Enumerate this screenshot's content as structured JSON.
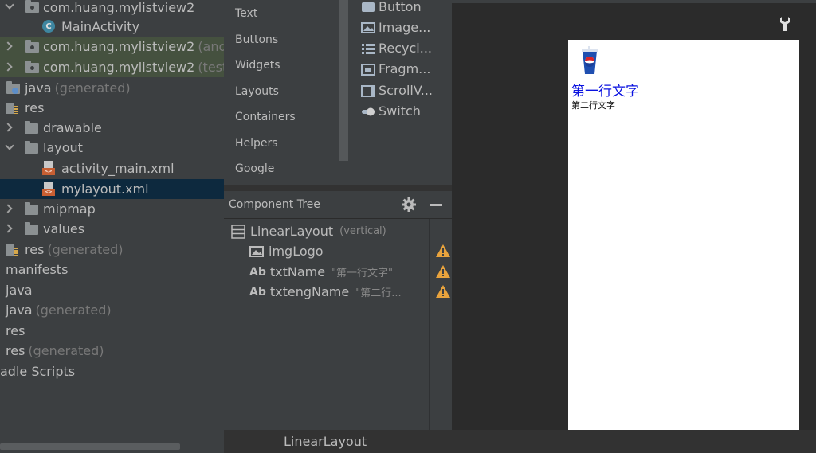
{
  "project_tree": {
    "rows": [
      {
        "label": "com.huang.mylistview2",
        "muted": ""
      },
      {
        "label": "MainActivity",
        "muted": ""
      },
      {
        "label": "com.huang.mylistview2",
        "muted": "(andro"
      },
      {
        "label": "com.huang.mylistview2",
        "muted": "(test)"
      },
      {
        "label": "java",
        "muted": "(generated)"
      },
      {
        "label": "res",
        "muted": ""
      },
      {
        "label": "drawable",
        "muted": ""
      },
      {
        "label": "layout",
        "muted": ""
      },
      {
        "label": "activity_main.xml",
        "muted": ""
      },
      {
        "label": "mylayout.xml",
        "muted": ""
      },
      {
        "label": "mipmap",
        "muted": ""
      },
      {
        "label": "values",
        "muted": ""
      },
      {
        "label": "res",
        "muted": "(generated)"
      },
      {
        "label": "manifests",
        "muted": ""
      },
      {
        "label": "java",
        "muted": ""
      },
      {
        "label": "java",
        "muted": "(generated)"
      },
      {
        "label": "res",
        "muted": ""
      },
      {
        "label": "res",
        "muted": "(generated)"
      },
      {
        "label": "adle Scripts",
        "muted": ""
      }
    ],
    "class_icon_letter": "C",
    "xml_tag": "<>"
  },
  "palette": {
    "categories": [
      "Text",
      "Buttons",
      "Widgets",
      "Layouts",
      "Containers",
      "Helpers",
      "Google"
    ],
    "items": [
      {
        "label": "Button",
        "icon": "button-icon"
      },
      {
        "label": "Image...",
        "icon": "image-icon"
      },
      {
        "label": "Recycl...",
        "icon": "list-icon"
      },
      {
        "label": "Fragm...",
        "icon": "fragment-icon"
      },
      {
        "label": "ScrollV...",
        "icon": "scrollview-icon"
      },
      {
        "label": "Switch",
        "icon": "switch-icon"
      }
    ]
  },
  "component_tree": {
    "title": "Component Tree",
    "root": {
      "label": "LinearLayout",
      "hint": "(vertical)"
    },
    "children": [
      {
        "prefix": "",
        "label": "imgLogo",
        "hint": ""
      },
      {
        "prefix": "Ab",
        "label": "txtName",
        "hint": "\"第一行文字\""
      },
      {
        "prefix": "Ab",
        "label": "txtengName",
        "hint": "\"第二行..."
      }
    ]
  },
  "design": {
    "txt_name": "第一行文字",
    "txt_eng": "第二行文字"
  },
  "breadcrumb": "LinearLayout",
  "colors": {
    "panel": "#3c3f41",
    "editor": "#2b2b2b",
    "selected_row": "#0d293e",
    "green_row": "#45513f",
    "warning": "#e8a33d",
    "link_blue": "#0a12e0"
  }
}
